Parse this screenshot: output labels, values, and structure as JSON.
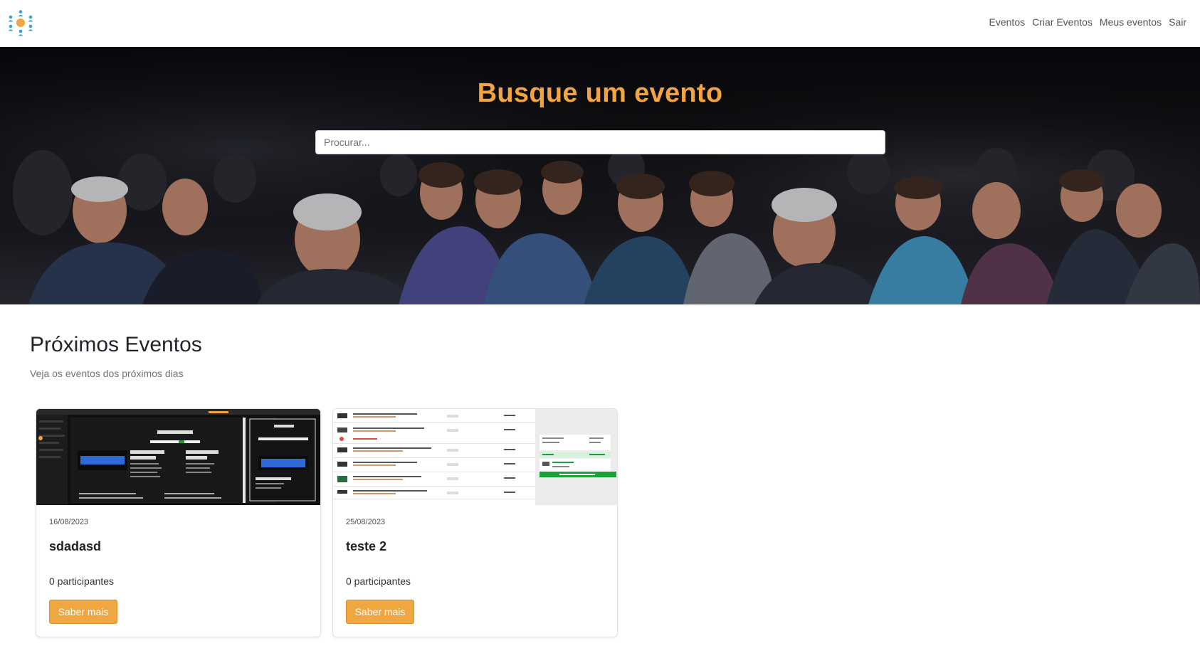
{
  "nav": {
    "logo_icon": "people-network-logo-icon",
    "links": [
      "Eventos",
      "Criar Eventos",
      "Meus eventos",
      "Sair"
    ]
  },
  "hero": {
    "title": "Busque um evento",
    "search_placeholder": "Procurar...",
    "background_image": "audience-seated-at-conference-photo"
  },
  "section": {
    "title": "Próximos Eventos",
    "subtitle": "Veja os eventos dos próximos dias"
  },
  "events": [
    {
      "date": "16/08/2023",
      "title": "sdadasd",
      "participants": "0 participantes",
      "button": "Saber mais",
      "thumbnail": "dark-product-page-screenshot"
    },
    {
      "date": "25/08/2023",
      "title": "teste 2",
      "participants": "0 participantes",
      "button": "Saber mais",
      "thumbnail": "shopping-cart-screenshot"
    }
  ],
  "colors": {
    "accent": "#f2a441",
    "button": "#f0a641",
    "hero_bg": "#121216"
  }
}
